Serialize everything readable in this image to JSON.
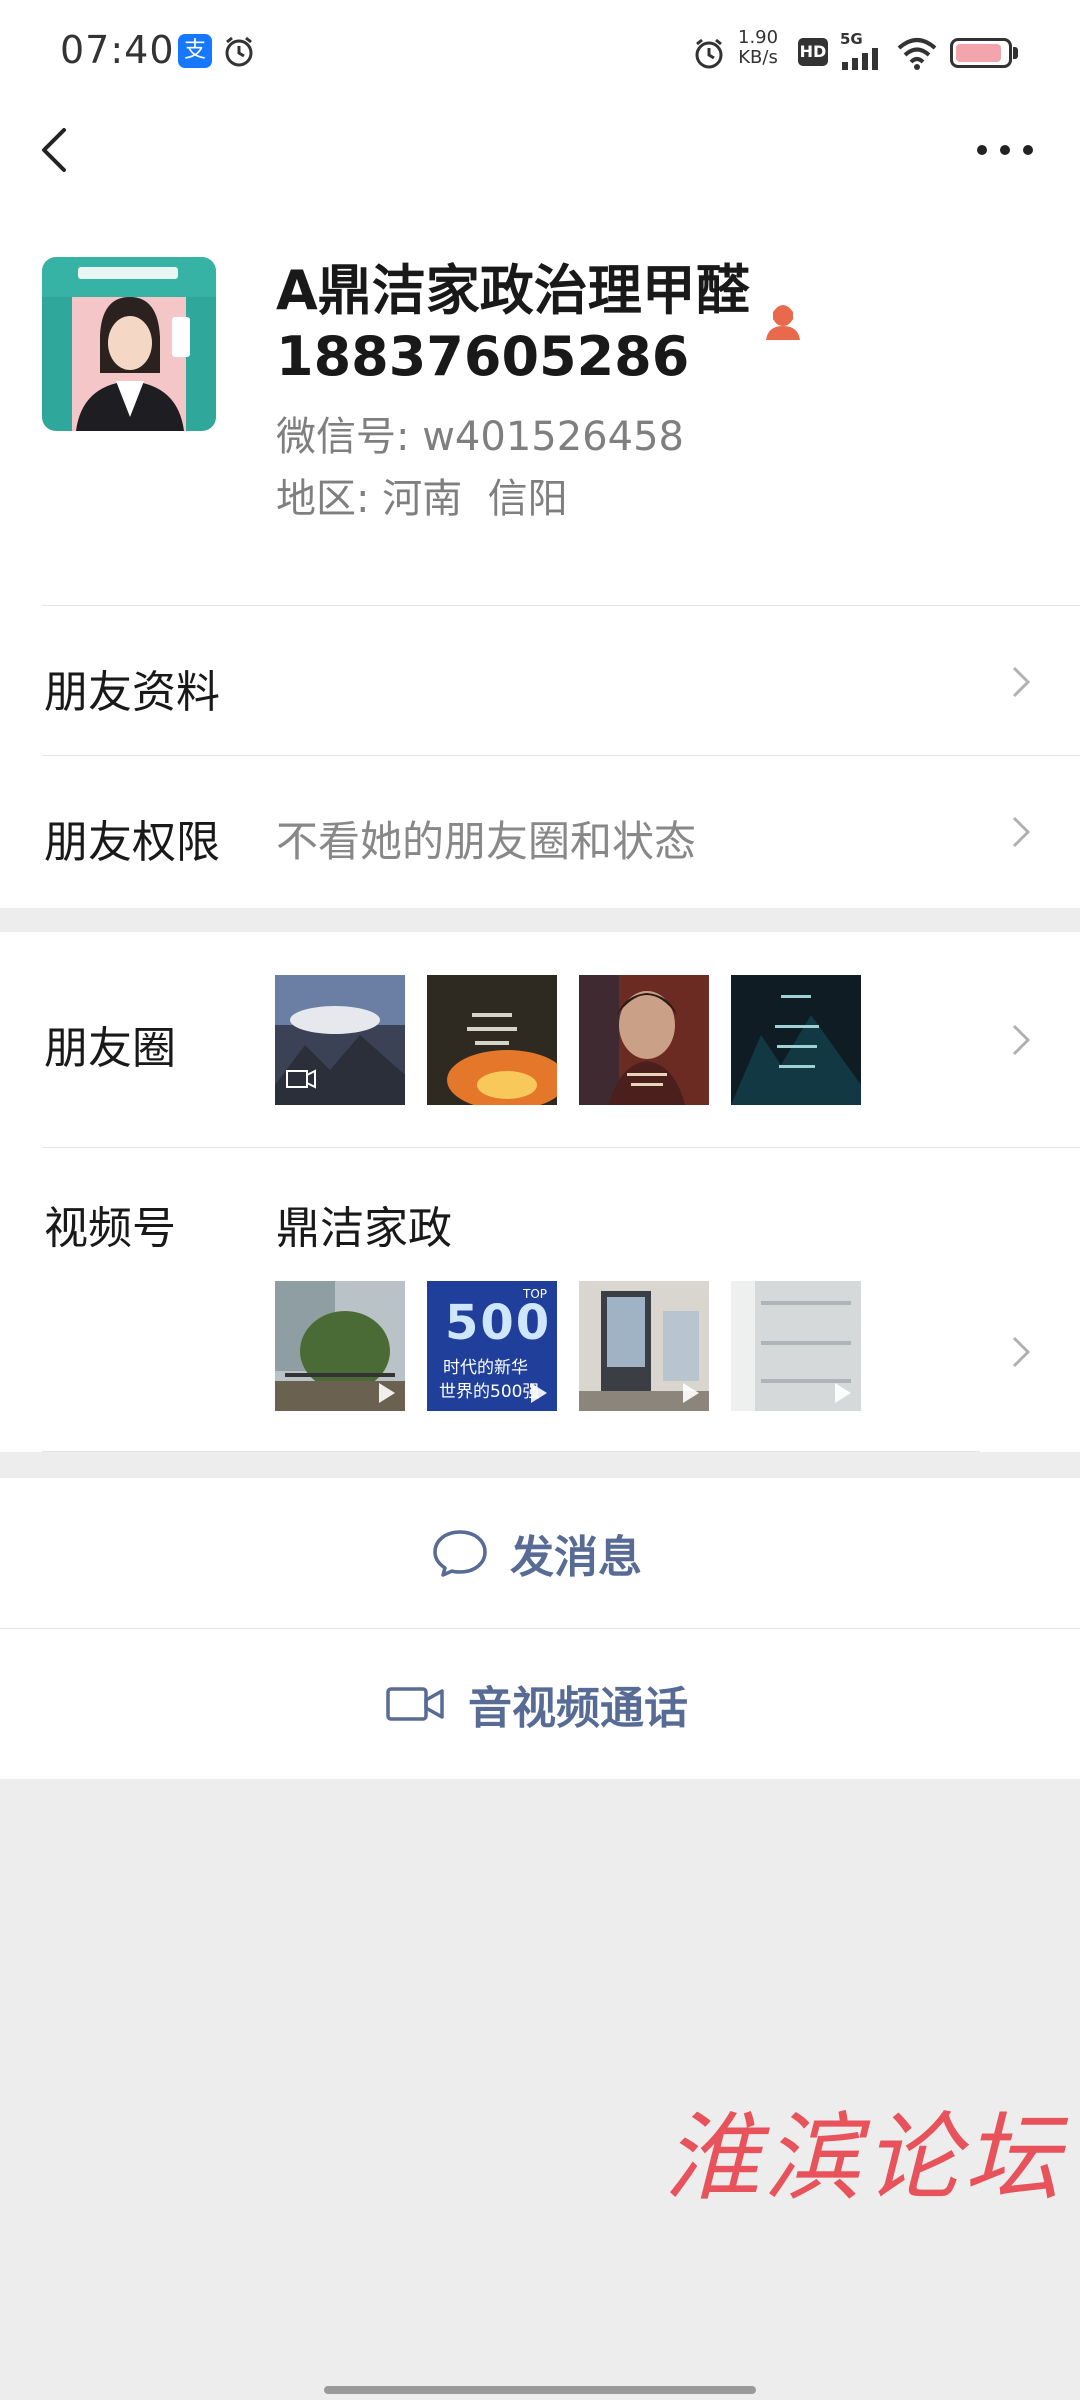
{
  "status_bar": {
    "time": "07:40",
    "alipay_glyph": "支",
    "net_speed_value": "1.90",
    "net_speed_unit": "KB/s",
    "hd_label": "HD",
    "signal_label": "5G",
    "icons": [
      "alipay-icon",
      "alarm-icon",
      "alarm-icon",
      "hd-icon",
      "signal-icon",
      "wifi-icon",
      "battery-icon"
    ],
    "battery_level": 0.9,
    "battery_color": "#f4a4ac"
  },
  "nav": {
    "back_icon": "chevron-left-icon",
    "more_icon": "more-dots-icon"
  },
  "profile": {
    "name_line1": "A鼎洁家政治理甲醛",
    "name_line2": "18837605286",
    "gender_icon": "female-icon",
    "wechat_id_label": "微信号:",
    "wechat_id": "w401526458",
    "region_label": "地区:",
    "region": "河南  信阳"
  },
  "rows": {
    "friend_info": {
      "label": "朋友资料"
    },
    "friend_permission": {
      "label": "朋友权限",
      "value": "不看她的朋友圈和状态"
    },
    "moments": {
      "label": "朋友圈"
    },
    "channels": {
      "label": "视频号",
      "channel_name": "鼎洁家政",
      "thumb2_line1": "500",
      "thumb2_top": "TOP",
      "thumb2_line2": "时代的新华",
      "thumb2_line3": "世界的500强"
    }
  },
  "actions": {
    "send_message": "发消息",
    "video_call": "音视频通话",
    "accent_color": "#576b95"
  },
  "watermark": "淮滨论坛"
}
